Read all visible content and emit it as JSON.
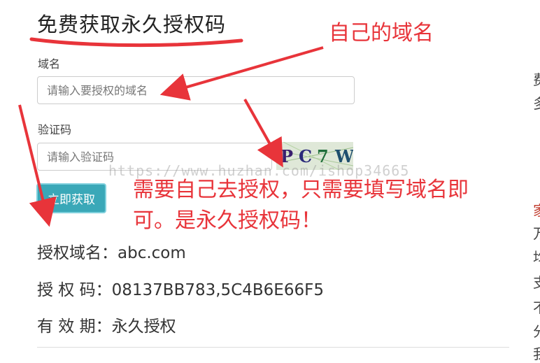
{
  "page": {
    "title": "免费获取永久授权码"
  },
  "form": {
    "domain_label": "域名",
    "domain_placeholder": "请输入要授权的域名",
    "captcha_label": "验证码",
    "captcha_placeholder": "请输入验证码",
    "captcha_chars": [
      "P",
      "C",
      "7",
      "W"
    ],
    "submit_label": "立即获取"
  },
  "result": {
    "domain_key": "授权域名：",
    "domain_value": "abc.com",
    "code_key": "授 权 码：",
    "code_value": "08137BB783,5C4B6E66F5",
    "validity_key": "有 效 期：",
    "validity_value": "永久授权"
  },
  "annotations": {
    "own_domain": "自己的域名",
    "note_line1": "需要自己去授权，只需要填写域名即",
    "note_line2": "可。是永久授权码！"
  },
  "watermark": "https://www.huzhan.com/ishop34665",
  "sidebar_fragments": [
    "费",
    "多",
    "家",
    "万",
    "均",
    "支",
    "不",
    "分",
    "我"
  ],
  "colors": {
    "accent": "#3aa8b8",
    "annotation": "#e8343a"
  }
}
